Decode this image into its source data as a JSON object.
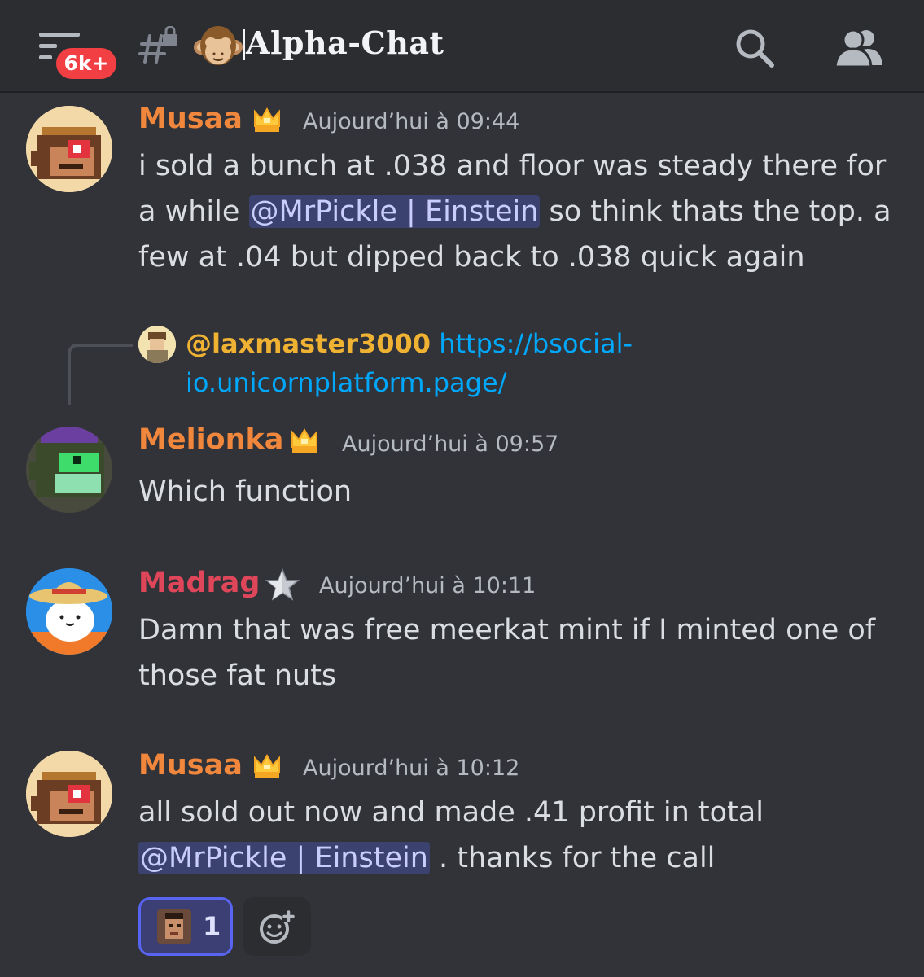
{
  "header": {
    "badge": "6k+",
    "channel_emoji": "monkey-icon",
    "channel_name": "Alpha-Chat",
    "icons": [
      "hamburger-icon",
      "locked-hash-icon",
      "search-icon",
      "members-icon"
    ]
  },
  "messages": [
    {
      "username": "Musaa",
      "name_color": "#f0873c",
      "badge_icon": "crown-icon",
      "timestamp": "Aujourd’hui à 09:44",
      "text_a": "i sold a bunch at .038 and floor was steady there for a while ",
      "mention": "@MrPickle | Einstein",
      "text_b": " so think thats the top. a few at .04 but dipped back to .038 quick again"
    },
    {
      "reply_user": "@laxmaster3000",
      "reply_link": "https://bsocial-io.unicornplatform.page/",
      "username": "Melionka",
      "name_color": "#f0873c",
      "badge_icon": "crown-icon",
      "timestamp": "Aujourd’hui à 09:57",
      "text": "Which function"
    },
    {
      "username": "Madrag",
      "name_color": "#e0465a",
      "badge_icon": "star-icon",
      "timestamp": "Aujourd’hui à 10:11",
      "text": "Damn that was free meerkat mint if I minted one of those fat nuts"
    },
    {
      "username": "Musaa",
      "name_color": "#f0873c",
      "badge_icon": "crown-icon",
      "timestamp": "Aujourd’hui à 10:12",
      "text_a": "all sold out now and made .41 profit in total ",
      "mention": "@MrPickle | Einstein",
      "text_b": " . thanks for the call",
      "reaction_count": "1"
    }
  ],
  "colors": {
    "background": "#313338",
    "header": "#2b2d31",
    "mention_bg": "#3c4270",
    "link": "#00a8fc",
    "reply_user": "#f0b232",
    "reaction_border": "#5865f2"
  }
}
